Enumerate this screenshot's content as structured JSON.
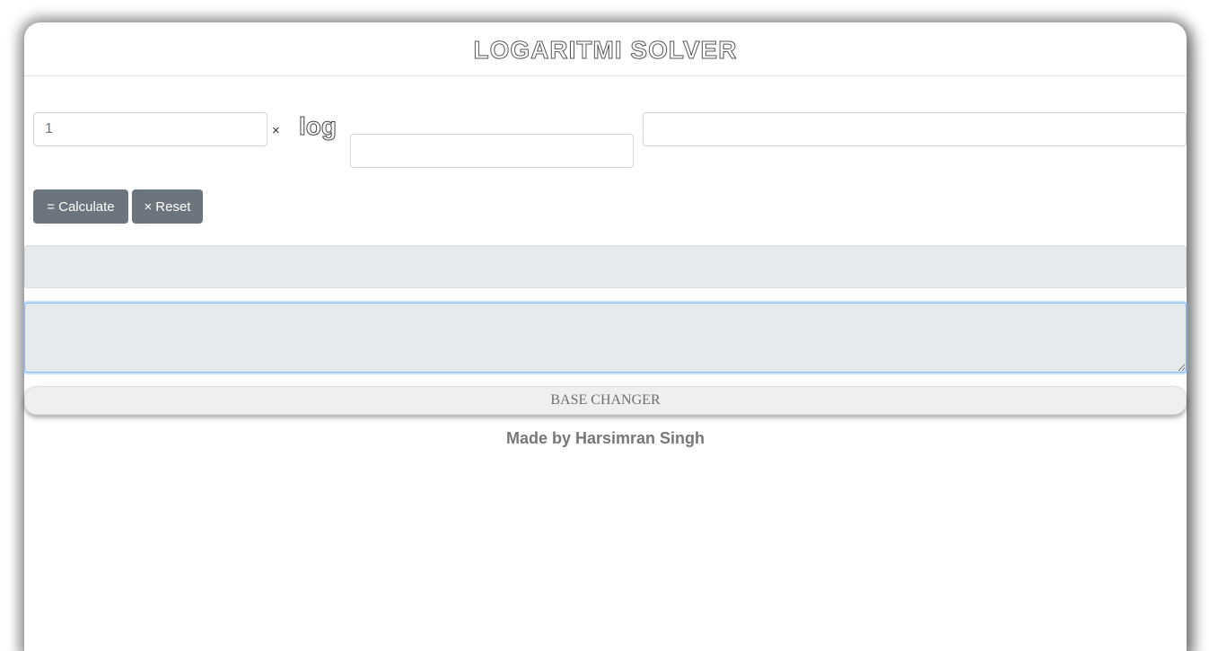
{
  "header": {
    "title": "LOGARITMI SOLVER"
  },
  "form": {
    "coefficient_value": "1",
    "times_symbol": "×",
    "log_label": "log",
    "base_value": "",
    "argument_value": ""
  },
  "buttons": {
    "calculate_icon": "=",
    "calculate_label": "Calculate",
    "reset_icon": "×",
    "reset_label": "Reset",
    "color": "#6c757d"
  },
  "result": {
    "value": "",
    "steps_value": ""
  },
  "base_changer": {
    "label": "BASE CHANGER"
  },
  "footer": {
    "credit": "Made by Harsimran Singh"
  }
}
